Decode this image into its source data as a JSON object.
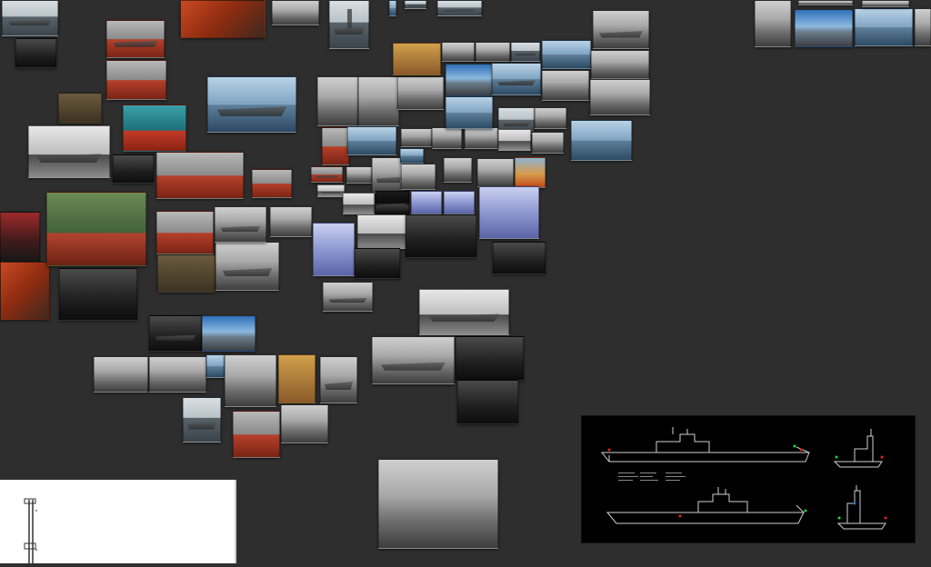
{
  "view": {
    "background": "#2e2e2e"
  },
  "thumbnails": [
    {
      "id": "t01",
      "style": "sea ship"
    },
    {
      "id": "t02",
      "style": "dark"
    },
    {
      "id": "t03",
      "style": "red ship"
    },
    {
      "id": "t04",
      "style": "red2"
    },
    {
      "id": "t05",
      "style": "gray"
    },
    {
      "id": "t06",
      "style": "sea ship tower"
    },
    {
      "id": "t07",
      "style": "sea2"
    },
    {
      "id": "t08",
      "style": "sea ship"
    },
    {
      "id": "t09",
      "style": "sea ship"
    },
    {
      "id": "t10",
      "style": "brown"
    },
    {
      "id": "t11",
      "style": "teal"
    },
    {
      "id": "t12",
      "style": "gray2 ship"
    },
    {
      "id": "t13",
      "style": "red"
    },
    {
      "id": "t14",
      "style": "sea2 ship"
    },
    {
      "id": "t15",
      "style": "red"
    },
    {
      "id": "t16",
      "style": "pink"
    },
    {
      "id": "t17",
      "style": "red2"
    },
    {
      "id": "t18",
      "style": "green"
    },
    {
      "id": "t19",
      "style": "red"
    },
    {
      "id": "t20",
      "style": "red"
    },
    {
      "id": "t21",
      "style": "dark"
    },
    {
      "id": "t22",
      "style": "brown"
    },
    {
      "id": "t23",
      "style": "gray ship"
    },
    {
      "id": "t24",
      "style": "gray"
    },
    {
      "id": "t25",
      "style": "gray ship"
    },
    {
      "id": "t26",
      "style": "dark"
    },
    {
      "id": "t27",
      "style": "gray"
    },
    {
      "id": "t28",
      "style": "gray"
    },
    {
      "id": "t29",
      "style": "gray"
    },
    {
      "id": "t30",
      "style": "warm"
    },
    {
      "id": "t31",
      "style": "gray"
    },
    {
      "id": "t32",
      "style": "gray"
    },
    {
      "id": "t33",
      "style": "sea ship"
    },
    {
      "id": "t34",
      "style": "sea2"
    },
    {
      "id": "t35",
      "style": "gray ship"
    },
    {
      "id": "t36",
      "style": "red"
    },
    {
      "id": "t37",
      "style": "sea2"
    },
    {
      "id": "t38",
      "style": "gray"
    },
    {
      "id": "t39",
      "style": "gray"
    },
    {
      "id": "t40",
      "style": "gray"
    },
    {
      "id": "t41",
      "style": "sea ship"
    },
    {
      "id": "t42",
      "style": "sky"
    },
    {
      "id": "t43",
      "style": "sea2 ship"
    },
    {
      "id": "t44",
      "style": "gray"
    },
    {
      "id": "t45",
      "style": "gray"
    },
    {
      "id": "t46",
      "style": "gray"
    },
    {
      "id": "t47",
      "style": "sea2"
    },
    {
      "id": "t48",
      "style": "gray"
    },
    {
      "id": "t49",
      "style": "sea2"
    },
    {
      "id": "t50",
      "style": "orange"
    },
    {
      "id": "t51",
      "style": "gray"
    },
    {
      "id": "t52",
      "style": "gray"
    },
    {
      "id": "t53",
      "style": "gray2"
    },
    {
      "id": "t54",
      "style": "gray"
    },
    {
      "id": "t55",
      "style": "red ship"
    },
    {
      "id": "t56",
      "style": "gray"
    },
    {
      "id": "t57",
      "style": "gray ship"
    },
    {
      "id": "t58",
      "style": "sea2"
    },
    {
      "id": "t59",
      "style": "gray"
    },
    {
      "id": "t60",
      "style": "gray2 ship"
    },
    {
      "id": "t61",
      "style": "gray2"
    },
    {
      "id": "t62",
      "style": "night ship"
    },
    {
      "id": "t63",
      "style": "blue"
    },
    {
      "id": "t64",
      "style": "blue"
    },
    {
      "id": "t65",
      "style": "blue"
    },
    {
      "id": "t66",
      "style": "blue"
    },
    {
      "id": "t67",
      "style": "gray2"
    },
    {
      "id": "t68",
      "style": "dark"
    },
    {
      "id": "t69",
      "style": "dark"
    },
    {
      "id": "t70",
      "style": "dark"
    },
    {
      "id": "t71",
      "style": "gray ship"
    },
    {
      "id": "t72",
      "style": "gray2 ship"
    },
    {
      "id": "t73",
      "style": "gray ship"
    },
    {
      "id": "t74",
      "style": "dark"
    },
    {
      "id": "t75",
      "style": "dark"
    },
    {
      "id": "t76",
      "style": "dark ship"
    },
    {
      "id": "t77",
      "style": "sky"
    },
    {
      "id": "t78",
      "style": "gray"
    },
    {
      "id": "t79",
      "style": "gray"
    },
    {
      "id": "t80",
      "style": "sea2"
    },
    {
      "id": "t81",
      "style": "gray"
    },
    {
      "id": "t82",
      "style": "warm"
    },
    {
      "id": "t83",
      "style": "gray ship"
    },
    {
      "id": "t84",
      "style": "sea ship"
    },
    {
      "id": "t85",
      "style": "red"
    },
    {
      "id": "t86",
      "style": "gray"
    },
    {
      "id": "t87",
      "style": "gray"
    },
    {
      "id": "t88",
      "style": "gray"
    }
  ],
  "whitedoc": {
    "style": "plain"
  },
  "blueprint": {
    "style": "dark"
  }
}
